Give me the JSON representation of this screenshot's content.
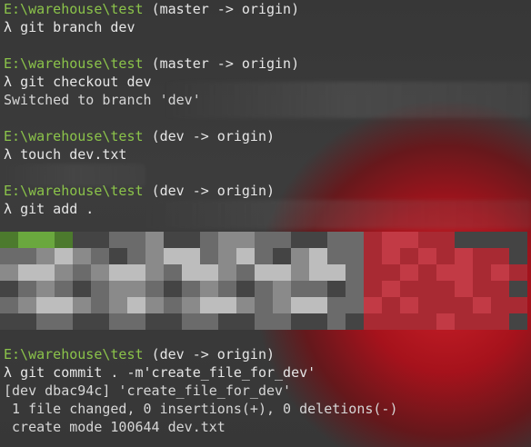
{
  "terminal": {
    "prompt_symbol": "λ",
    "path_label": "E:\\warehouse\\test",
    "blocks": [
      {
        "branch": "(master -> origin)",
        "command": "git branch dev",
        "output": []
      },
      {
        "branch": "(master -> origin)",
        "command": "git checkout dev",
        "output": [
          "Switched to branch 'dev'"
        ]
      },
      {
        "branch": "(dev -> origin)",
        "command": "touch dev.txt",
        "output": []
      },
      {
        "branch": "(dev -> origin)",
        "command": "git add .",
        "output": []
      },
      {
        "branch": "(dev -> origin)",
        "command": "git commit . -m'create_file_for_dev'",
        "output": [
          "[dev dbac94c] 'create_file_for_dev'",
          " 1 file changed, 0 insertions(+), 0 deletions(-)",
          " create mode 100644 dev.txt"
        ]
      }
    ]
  },
  "colors": {
    "background": "#2f2f2f",
    "path": "#8bc34a",
    "text": "#e6e6e6",
    "accent_red": "#c23a45"
  }
}
